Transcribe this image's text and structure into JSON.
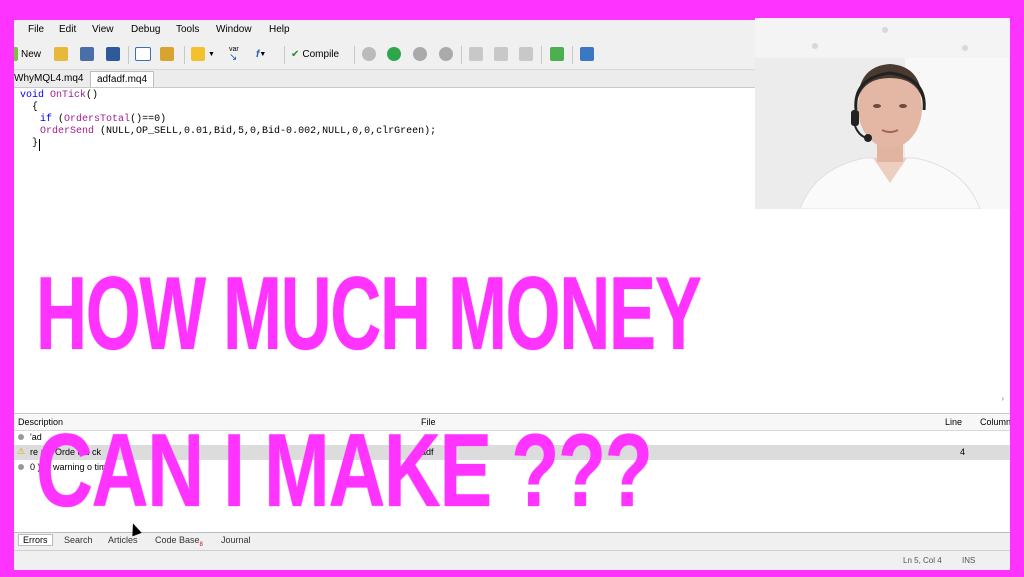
{
  "menu": [
    "File",
    "Edit",
    "View",
    "Debug",
    "Tools",
    "Window",
    "Help"
  ],
  "toolbar": {
    "new_label": "New",
    "compile_label": "Compile",
    "var_label": "var",
    "fx_label": "f"
  },
  "tabs": [
    "WhyMQL4.mq4",
    "adfadf.mq4"
  ],
  "code": {
    "line1": {
      "kw": "void",
      "fn": "OnTick",
      "rest": "()"
    },
    "line2": "{",
    "line3": {
      "kw": "if",
      "rest_open": "(",
      "fn": "OrdersTotal",
      "rest_close": "()==0)"
    },
    "line4": {
      "fn": "OrderSend",
      "args": "(NULL,OP_SELL,0.01,Bid,5,0,Bid-0.002,NULL,0,0,clrGreen);"
    },
    "line5": "}"
  },
  "errors": {
    "columns": {
      "description": "Description",
      "file": "File",
      "line": "Line",
      "column": "Column"
    },
    "rows": [
      {
        "description": "'ad",
        "file": "",
        "line": ""
      },
      {
        "description": "re  alu   Orde        uld     ck",
        "file": "adf",
        "line": "4"
      },
      {
        "description": "0     ), 1 warning       o    tim",
        "file": "",
        "line": ""
      }
    ]
  },
  "bottom_tabs": [
    "Errors",
    "Search",
    "Articles",
    "Code Base",
    "Journal"
  ],
  "bottom_badge": "8",
  "status": {
    "position": "Ln 5, Col 4",
    "mode": "INS"
  },
  "headline": {
    "line1": "HOW MUCH MONEY",
    "line2": "CAN I MAKE ???"
  },
  "colors": {
    "accent": "#ff33ff"
  }
}
